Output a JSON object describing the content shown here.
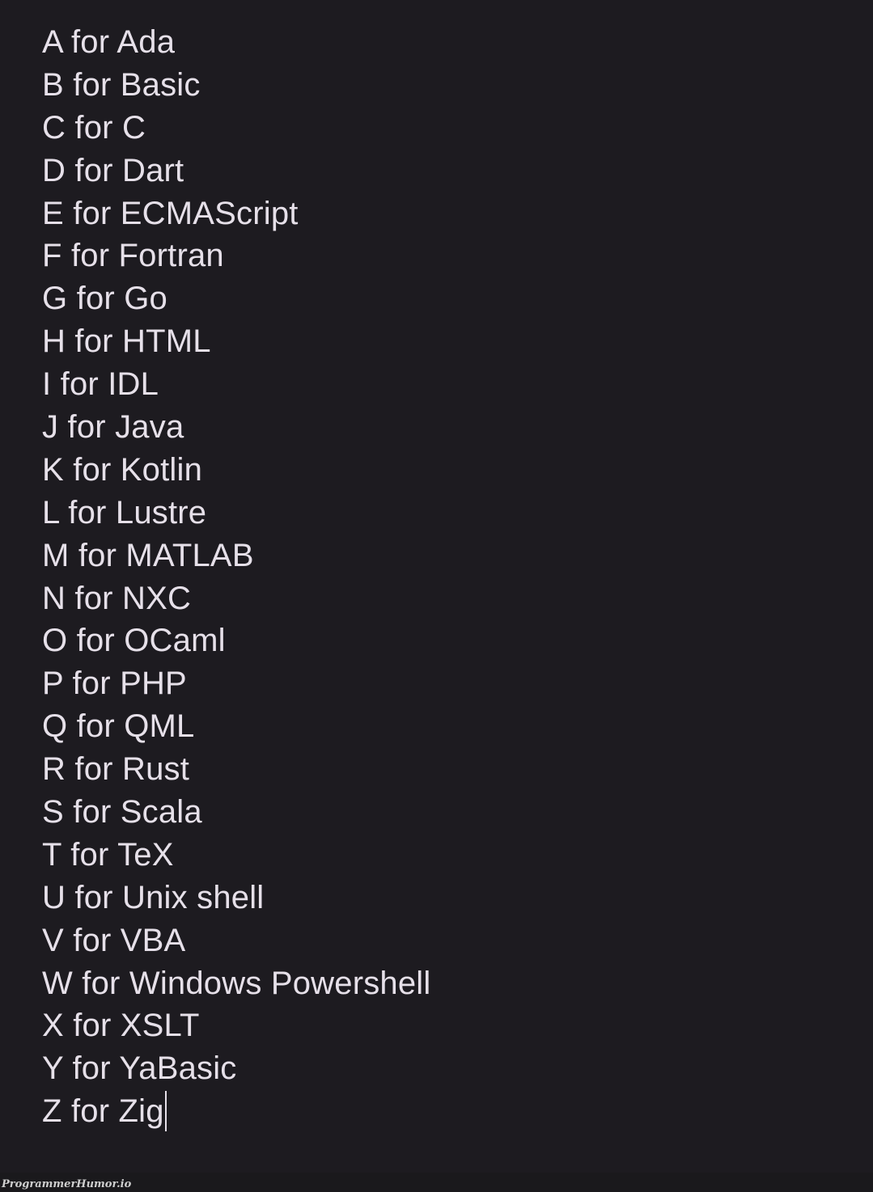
{
  "editor": {
    "lines": [
      "A for Ada",
      "B for Basic",
      "C for C",
      "D for Dart",
      "E for ECMAScript",
      "F for Fortran",
      "G for Go",
      "H for HTML",
      "I for IDL",
      "J for Java",
      "K for Kotlin",
      "L for Lustre",
      "M for MATLAB",
      "N for NXC",
      "O for OCaml",
      "P for PHP",
      "Q for QML",
      "R for Rust",
      "S for Scala",
      "T for TeX",
      "U for Unix shell",
      "V for VBA",
      "W for Windows Powershell",
      "X for XSLT",
      "Y for YaBasic",
      "Z for Zig"
    ],
    "text_color": "#e6e0e9",
    "background_color": "#1d1b20"
  },
  "watermark": {
    "text": "ProgrammerHumor.io"
  }
}
